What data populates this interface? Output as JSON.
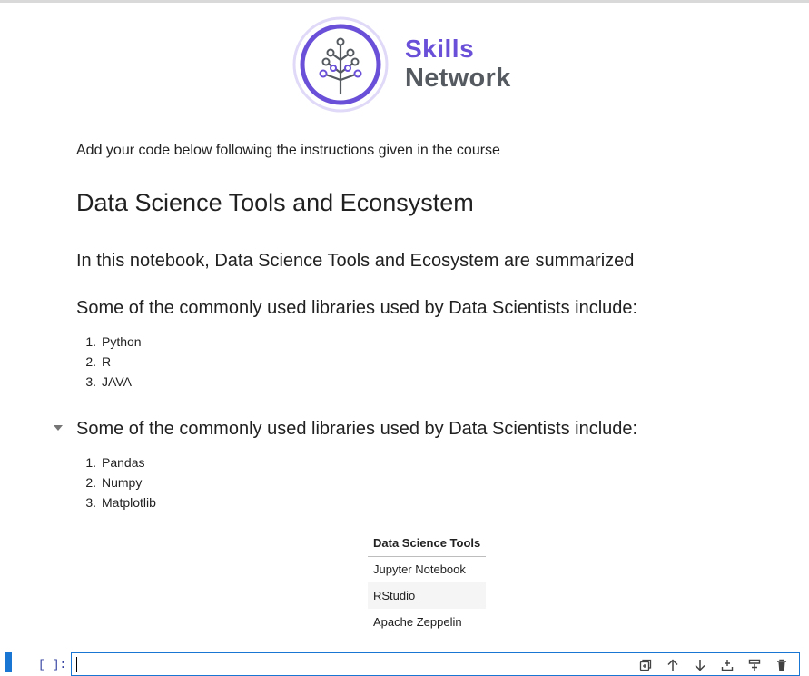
{
  "logo": {
    "line1": "Skills",
    "line2": "Network",
    "brand_color": "#6a4fd8",
    "text_color": "#555a60"
  },
  "notebook": {
    "intro": "Add your code below following the instructions given in the course",
    "title": "Data Science Tools and Econsystem",
    "subtitle": "In this notebook, Data Science Tools and Ecosystem are summarized",
    "section1": {
      "heading": "Some of the commonly used libraries used by Data Scientists include:",
      "items": [
        {
          "num": "1.",
          "label": "Python"
        },
        {
          "num": "2.",
          "label": "R"
        },
        {
          "num": "3.",
          "label": "JAVA"
        }
      ]
    },
    "section2": {
      "heading": "Some of the commonly used libraries used by Data Scientists include:",
      "items": [
        {
          "num": "1.",
          "label": "Pandas"
        },
        {
          "num": "2.",
          "label": "Numpy"
        },
        {
          "num": "3.",
          "label": "Matplotlib"
        }
      ]
    },
    "table": {
      "header": "Data Science Tools",
      "rows": [
        "Jupyter Notebook",
        "RStudio",
        "Apache Zeppelin"
      ]
    },
    "code_cell": {
      "prompt": "[ ]:",
      "value": ""
    }
  },
  "cell_toolbar": {
    "icons": [
      "duplicate-icon",
      "move-up-icon",
      "move-down-icon",
      "insert-below-icon",
      "insert-above-icon",
      "delete-icon"
    ]
  },
  "accent_color": "#1976d2"
}
